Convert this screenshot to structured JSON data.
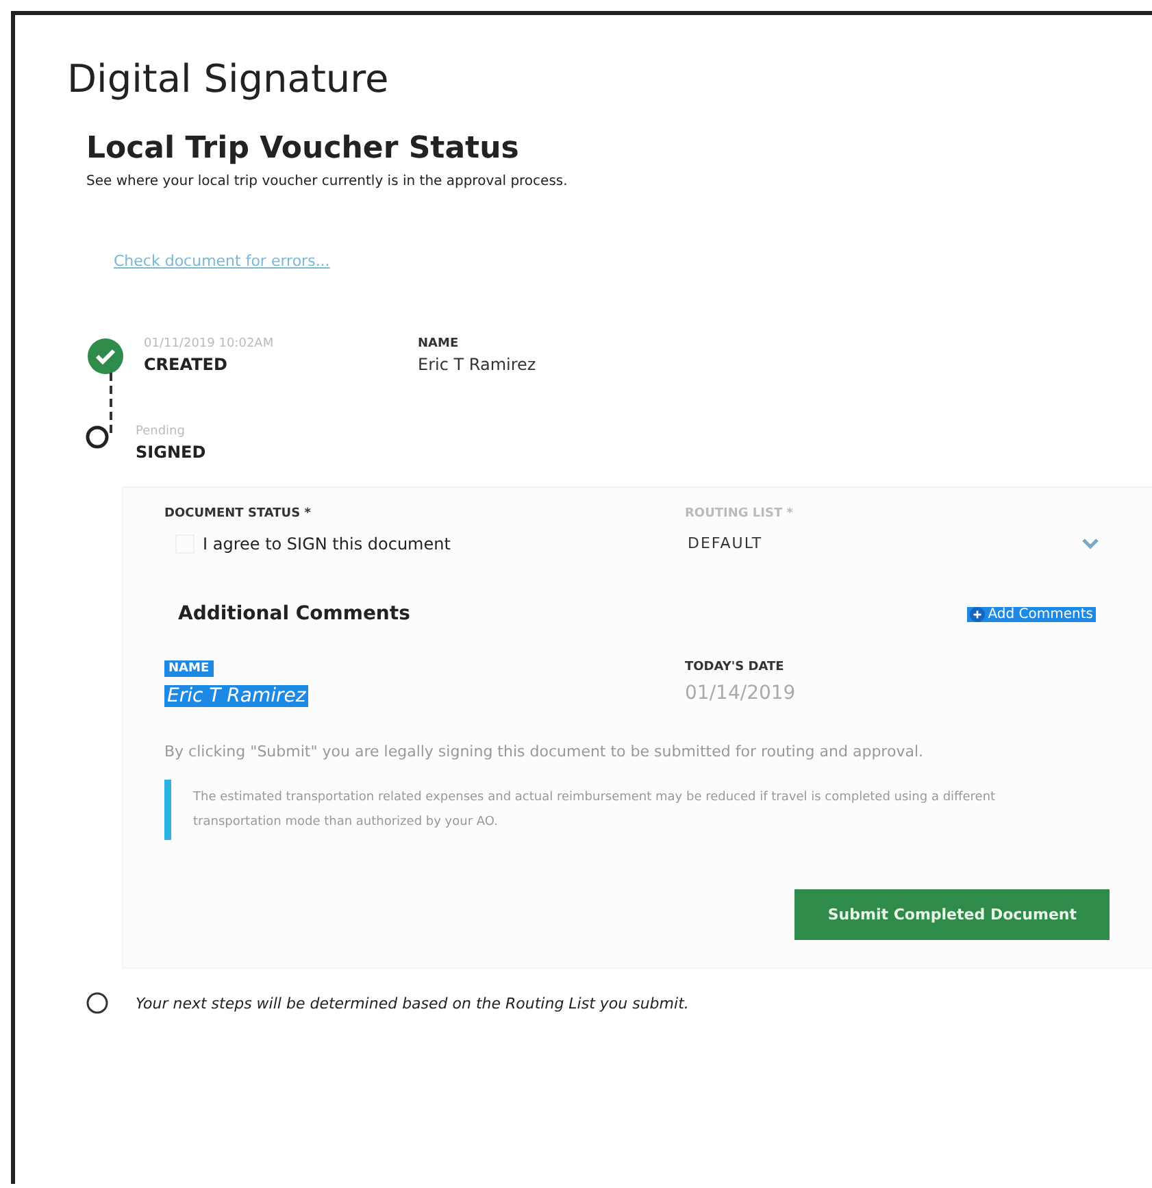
{
  "window": {
    "title": "Digital Signature"
  },
  "section": {
    "title": "Local Trip Voucher Status",
    "subtitle": "See where your local trip voucher currently is in the approval process.",
    "link": "Check document for errors..."
  },
  "steps": [
    {
      "kind": "done",
      "time": "01/11/2019 10:02AM",
      "status": "CREATED",
      "name_label": "NAME",
      "name": "Eric T Ramirez"
    },
    {
      "kind": "current",
      "time": "Pending",
      "status": "SIGNED"
    },
    {
      "kind": "next",
      "text": "Your next steps will be determined based on the Routing List you submit."
    }
  ],
  "form": {
    "document_status": {
      "label": "DOCUMENT STATUS *",
      "option": "I agree to SIGN this document",
      "checked": false
    },
    "routing_list": {
      "label": "ROUTING LIST *",
      "value": "DEFAULT",
      "disabled": true
    },
    "comments": {
      "title": "Additional Comments",
      "button": "Add Comments",
      "highlighted": true
    },
    "signer": {
      "label": "NAME",
      "value": "Eric T Ramirez",
      "highlighted": true
    },
    "date": {
      "label": "TODAY'S DATE",
      "value": "01/14/2019"
    },
    "disclaimer": "By clicking \"Submit\" you are legally signing this document to be submitted for routing and approval.",
    "note": "The estimated transportation related expenses and actual reimbursement may be reduced if travel is completed using a different transportation mode than authorized by your AO.",
    "submit": "Submit Completed Document"
  }
}
